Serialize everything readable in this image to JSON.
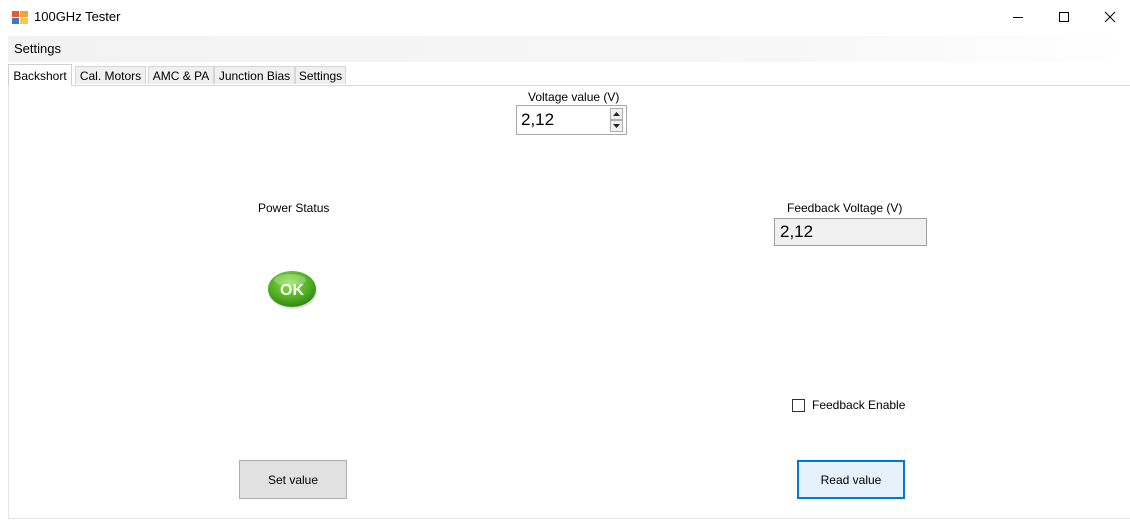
{
  "window": {
    "title": "100GHz Tester",
    "controls": {
      "minimize": "minimize-icon",
      "maximize": "maximize-icon",
      "close": "close-icon"
    }
  },
  "menubar": {
    "items": [
      {
        "label": "Settings"
      }
    ]
  },
  "tabs": [
    {
      "label": "Backshort",
      "active": true
    },
    {
      "label": "Cal. Motors",
      "active": false
    },
    {
      "label": "AMC & PA",
      "active": false
    },
    {
      "label": "Junction Bias",
      "active": false
    },
    {
      "label": "Settings",
      "active": false
    }
  ],
  "backshort": {
    "voltage_label": "Voltage value (V)",
    "voltage_value": "2,12",
    "power_status_label": "Power Status",
    "power_status_icon": "ok-status-icon",
    "power_status_text": "OK",
    "feedback_voltage_label": "Feedback Voltage (V)",
    "feedback_voltage_value": "2,12",
    "feedback_enable_label": "Feedback Enable",
    "feedback_enable_checked": false,
    "set_button_label": "Set value",
    "read_button_label": "Read value"
  },
  "colors": {
    "focus_border": "#0078d7",
    "ok_green": "#5cb82a",
    "button_face": "#e1e1e1"
  }
}
